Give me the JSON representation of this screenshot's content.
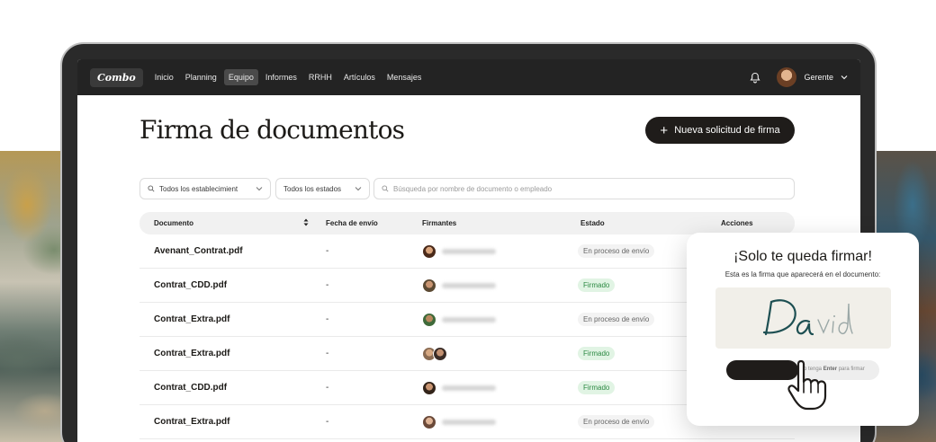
{
  "nav": {
    "logo": "Combo",
    "items": [
      {
        "label": "Inicio"
      },
      {
        "label": "Planning"
      },
      {
        "label": "Equipo",
        "active": true
      },
      {
        "label": "Informes"
      },
      {
        "label": "RRHH"
      },
      {
        "label": "Artículos"
      },
      {
        "label": "Mensajes"
      }
    ],
    "user_name": "Gerente",
    "icons": [
      "bell-icon",
      "chevron-down-icon"
    ]
  },
  "page": {
    "title": "Firma de documentos",
    "new_button": "Nueva solicitud de firma"
  },
  "filters": {
    "establishment": "Todos los establecimient",
    "state": "Todos los estados",
    "search_placeholder": "Búsqueda por nombre de documento o empleado"
  },
  "table": {
    "columns": [
      "Documento",
      "Fecha de envío",
      "Firmantes",
      "Estado",
      "Acciones"
    ],
    "rows": [
      {
        "document": "Avenant_Contrat.pdf",
        "date": "-",
        "status": "En proceso de envío",
        "status_type": "sending"
      },
      {
        "document": "Contrat_CDD.pdf",
        "date": "-",
        "status": "Firmado",
        "status_type": "signed"
      },
      {
        "document": "Contrat_Extra.pdf",
        "date": "-",
        "status": "En proceso de envío",
        "status_type": "sending"
      },
      {
        "document": "Contrat_Extra.pdf",
        "date": "-",
        "status": "Firmado",
        "status_type": "signed"
      },
      {
        "document": "Contrat_CDD.pdf",
        "date": "-",
        "status": "Firmado",
        "status_type": "signed"
      },
      {
        "document": "Contrat_Extra.pdf",
        "date": "-",
        "status": "En proceso de envío",
        "status_type": "sending"
      }
    ]
  },
  "signature_card": {
    "title": "¡Solo te queda firmar!",
    "subtitle": "Esta es la firma que aparecerá en el documento:",
    "signature": "David",
    "hint_prefix": "o tenga",
    "hint_key": "Enter",
    "hint_suffix": "para firmar"
  },
  "colors": {
    "nav_bg": "#232323",
    "primary": "#1f1c1a",
    "signed_bg": "#e1f4e4",
    "signed_text": "#2d8a44",
    "signature_ink": "#1d4f52"
  }
}
